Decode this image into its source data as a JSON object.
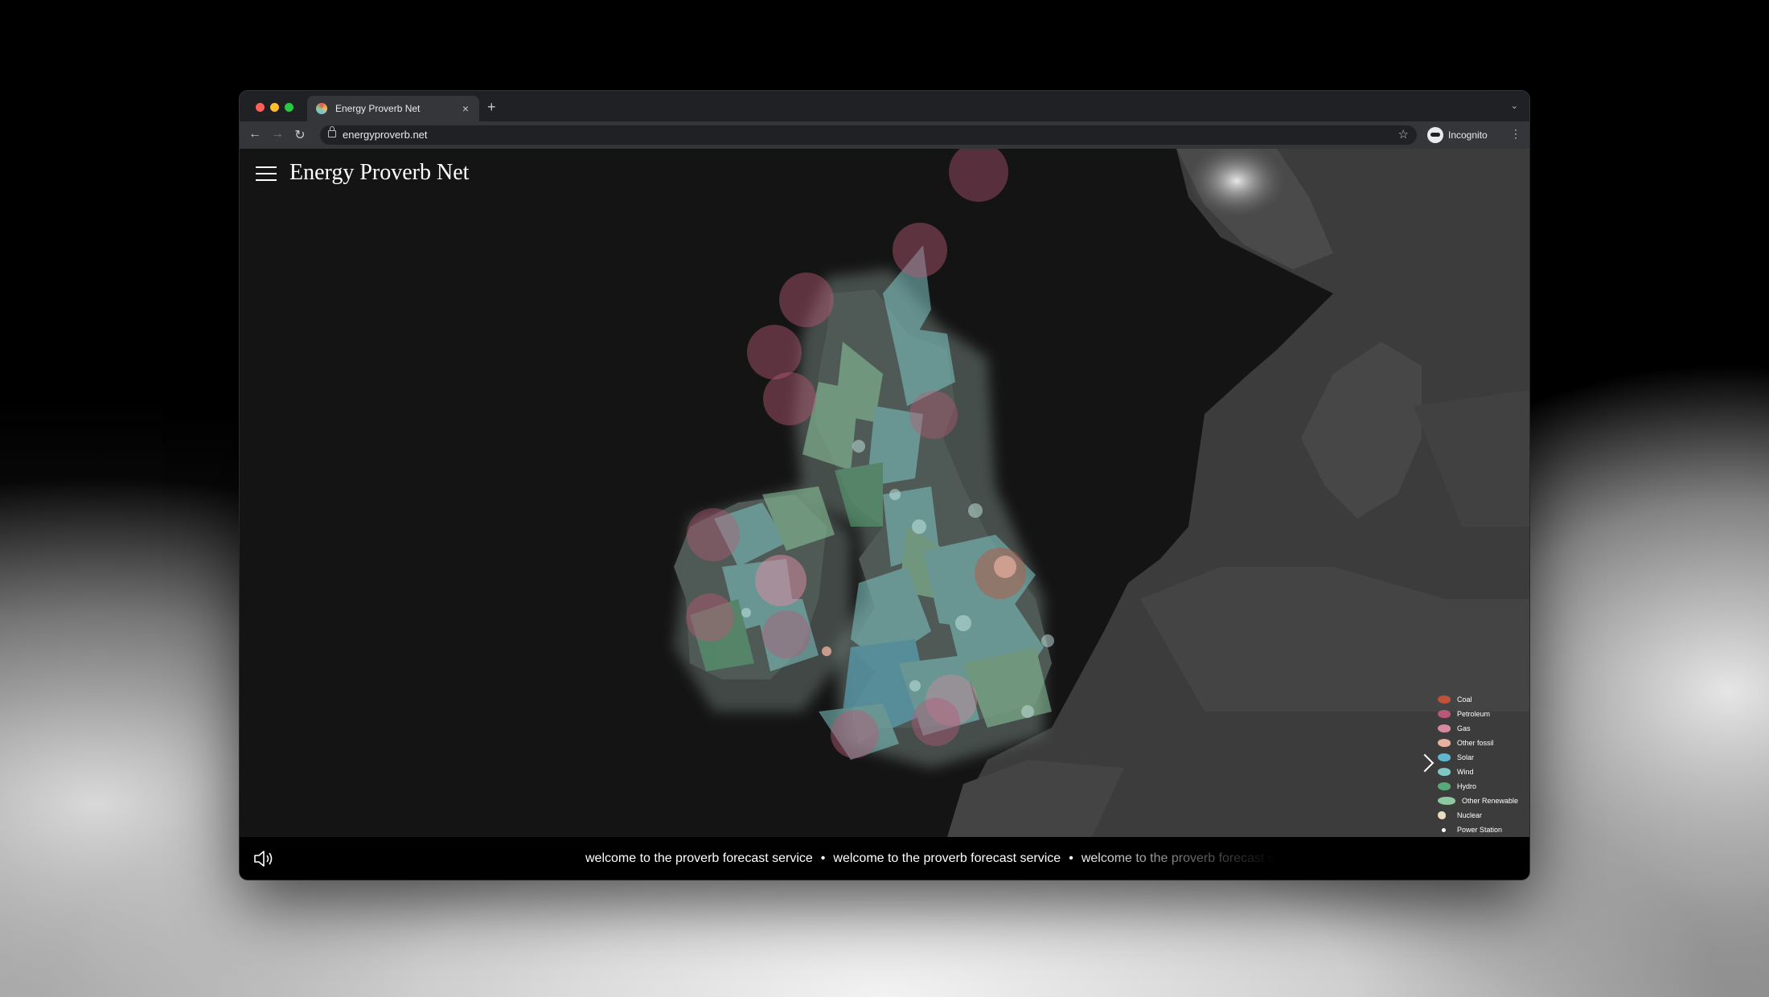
{
  "browser": {
    "tab_title": "Energy Proverb Net",
    "tab_close": "×",
    "new_tab": "+",
    "tab_menu": "⌄",
    "url": "energyproverb.net",
    "star": "☆",
    "incognito_label": "Incognito",
    "menu": "⋮",
    "back": "←",
    "forward": "→",
    "reload": "↻"
  },
  "colors": {
    "close": "#ff5f57",
    "minimize": "#febc2e",
    "maximize": "#28c840"
  },
  "site": {
    "title": "Energy Proverb Net"
  },
  "legend": [
    {
      "label": "Coal",
      "color": "#c0523c"
    },
    {
      "label": "Petroleum",
      "color": "#b85876"
    },
    {
      "label": "Gas",
      "color": "#d68aa0"
    },
    {
      "label": "Other fossil",
      "color": "#e8b0a0"
    },
    {
      "label": "Solar",
      "color": "#5fb8d0"
    },
    {
      "label": "Wind",
      "color": "#7fc7c4"
    },
    {
      "label": "Hydro",
      "color": "#5aa878"
    },
    {
      "label": "Other Renewable",
      "color": "#8ec8a0"
    },
    {
      "label": "Nuclear",
      "color": "#e8dcc0"
    },
    {
      "label": "Power Station",
      "color": "#ffffff"
    }
  ],
  "ticker": {
    "message": "welcome to the proverb forecast service",
    "separator": "•"
  }
}
